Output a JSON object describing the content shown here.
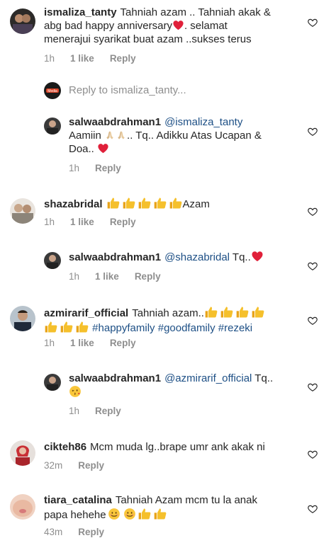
{
  "comments": [
    {
      "username": "ismaliza_tanty",
      "text1": "Tahniah azam .. Tahniah akak &",
      "text2": "abg bad happy anniversary",
      "text2b": ". selamat",
      "text3": "menerajui syarikat buat azam ..sukses terus",
      "time": "1h",
      "likes": "1 like",
      "reply": "Reply"
    },
    {
      "username": "salwaabdrahman1",
      "mention": "@ismaliza_tanty",
      "text1": "Aamiin",
      "text1b": ".. Tq.. Adikku Atas Ucapan &",
      "text2": "Doa..",
      "time": "1h",
      "reply": "Reply"
    },
    {
      "username": "shazabridal",
      "text1": "Azam",
      "time": "1h",
      "likes": "1 like",
      "reply": "Reply"
    },
    {
      "username": "salwaabdrahman1",
      "mention": "@shazabridal",
      "text1": "Tq..",
      "time": "1h",
      "likes": "1 like",
      "reply": "Reply"
    },
    {
      "username": "azmirarif_official",
      "text1": "Tahniah azam..",
      "tags": "#happyfamily #goodfamily #rezeki",
      "time": "1h",
      "likes": "1 like",
      "reply": "Reply"
    },
    {
      "username": "salwaabdrahman1",
      "mention": "@azmirarif_official",
      "text1": "Tq..",
      "time": "1h",
      "reply": "Reply"
    },
    {
      "username": "cikteh86",
      "text1": "Mcm muda lg..brape umr ank akak ni",
      "time": "32m",
      "reply": "Reply"
    },
    {
      "username": "tiara_catalina",
      "text1": "Tahniah Azam mcm tu la anak",
      "text2": "papa hehehe",
      "time": "43m",
      "reply": "Reply"
    }
  ],
  "reply_box": {
    "placeholder": "Reply to ismaliza_tanty..."
  },
  "colors": {
    "text": "#262626",
    "muted": "#8e8e8e",
    "link": "#1d4f85",
    "heart": "#ed4956",
    "thumb": "#f5b727"
  },
  "icons": {
    "like": "heart-outline-icon",
    "thumb": "thumbs-up-emoji",
    "heart": "red-heart-emoji"
  }
}
